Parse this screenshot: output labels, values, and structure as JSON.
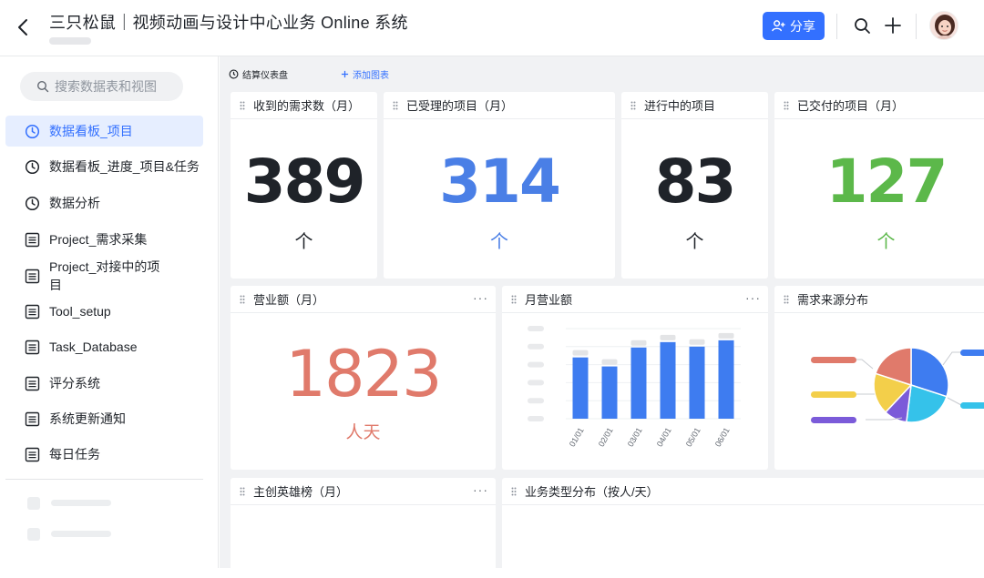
{
  "header": {
    "title": "三只松鼠｜视频动画与设计中心业务 Online 系统",
    "share_label": "分享",
    "icons": [
      "back-icon",
      "search-icon",
      "plus-icon",
      "user-avatar"
    ]
  },
  "sidebar": {
    "search_placeholder": "搜索数据表和视图",
    "items": [
      {
        "label": "数据看板_项目",
        "icon": "dashboard-icon",
        "active": true
      },
      {
        "label": "数据看板_进度_项目&任务",
        "icon": "dashboard-icon"
      },
      {
        "label": "数据分析",
        "icon": "dashboard-icon"
      },
      {
        "label": "Project_需求采集",
        "icon": "table-icon"
      },
      {
        "label": "Project_对接中的项目",
        "icon": "table-icon"
      },
      {
        "label": "Tool_setup",
        "icon": "table-icon"
      },
      {
        "label": "Task_Database",
        "icon": "table-icon"
      },
      {
        "label": "评分系统",
        "icon": "table-icon"
      },
      {
        "label": "系统更新通知",
        "icon": "table-icon"
      },
      {
        "label": "每日任务",
        "icon": "table-icon"
      }
    ]
  },
  "toolbar": {
    "dashboard_label": "结算仪表盘",
    "add_chart_label": "添加图表"
  },
  "colors": {
    "accent": "#3370ff",
    "number_blue": "#4a7fe6",
    "number_green": "#5cb84a",
    "number_red": "#e07a6b",
    "bar": "#3e7cf0"
  },
  "metrics": [
    {
      "title": "收到的需求数（月）",
      "value": "389",
      "unit": "个",
      "color": "#1f2329"
    },
    {
      "title": "已受理的项目（月）",
      "value": "314",
      "unit": "个",
      "color": "#4a7fe6"
    },
    {
      "title": "进行中的项目",
      "value": "83",
      "unit": "个",
      "color": "#1f2329"
    },
    {
      "title": "已交付的项目（月）",
      "value": "127",
      "unit": "个",
      "color": "#5cb84a"
    }
  ],
  "revenue": {
    "title": "营业额（月）",
    "value": "1823",
    "unit": "人天",
    "color": "#e07a6b"
  },
  "monthly_chart": {
    "title": "月营业额"
  },
  "pie_card": {
    "title": "需求来源分布"
  },
  "ranking_card": {
    "title": "主创英雄榜（月）"
  },
  "type_card": {
    "title": "业务类型分布（按人/天）"
  },
  "chart_data": [
    {
      "type": "bar",
      "categories": [
        "01/01",
        "02/01",
        "03/01",
        "04/01",
        "05/01",
        "06/01"
      ],
      "values": [
        68,
        58,
        79,
        85,
        80,
        87
      ],
      "ylim": [
        0,
        100
      ],
      "grid": true,
      "color": "#3e7cf0"
    },
    {
      "type": "pie",
      "values": [
        30,
        22,
        10,
        18,
        20
      ],
      "colors": [
        "#3e7cf0",
        "#35c2ea",
        "#7b5bd9",
        "#f3cf4a",
        "#e07a6b"
      ]
    }
  ]
}
